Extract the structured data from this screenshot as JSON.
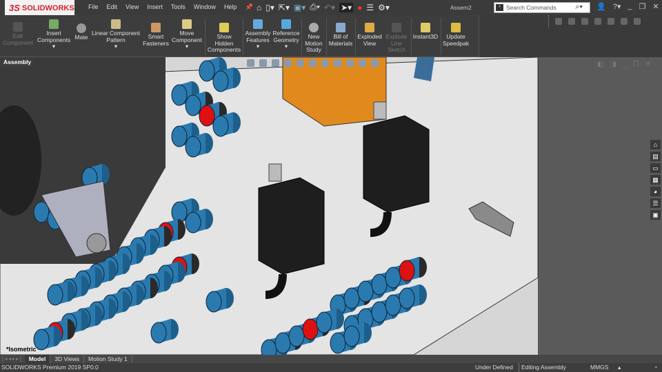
{
  "app": {
    "logo": "SOLIDWORKS",
    "document_title": "Assem2"
  },
  "menu": [
    "File",
    "Edit",
    "View",
    "Insert",
    "Tools",
    "Window",
    "Help"
  ],
  "search": {
    "placeholder": "Search Commands"
  },
  "ribbon": [
    {
      "label": "Edit Component",
      "enabled": false
    },
    {
      "label": "Insert Components",
      "enabled": true
    },
    {
      "label": "Mate",
      "enabled": true
    },
    {
      "label": "Linear Component Pattern",
      "enabled": true
    },
    {
      "label": "Smart Fasteners",
      "enabled": true
    },
    {
      "label": "Move Component",
      "enabled": true
    },
    {
      "label": "Show Hidden Components",
      "enabled": true
    },
    {
      "label": "Assembly Features",
      "enabled": true
    },
    {
      "label": "Reference Geometry",
      "enabled": true
    },
    {
      "label": "New Motion Study",
      "enabled": true
    },
    {
      "label": "Bill of Materials",
      "enabled": true
    },
    {
      "label": "Exploded View",
      "enabled": true
    },
    {
      "label": "Explode Line Sketch",
      "enabled": false
    },
    {
      "label": "Instant3D",
      "enabled": true
    },
    {
      "label": "Update Speedpak",
      "enabled": true
    }
  ],
  "command_tab": "Assembly",
  "view": {
    "orientation": "*Isometric"
  },
  "bottom_tabs": [
    "Model",
    "3D Views",
    "Motion Study 1"
  ],
  "status": {
    "product": "SOLIDWORKS Premium 2019 SP0.0",
    "state": "Under Defined",
    "mode": "Editing Assembly",
    "units": "MMGS"
  }
}
